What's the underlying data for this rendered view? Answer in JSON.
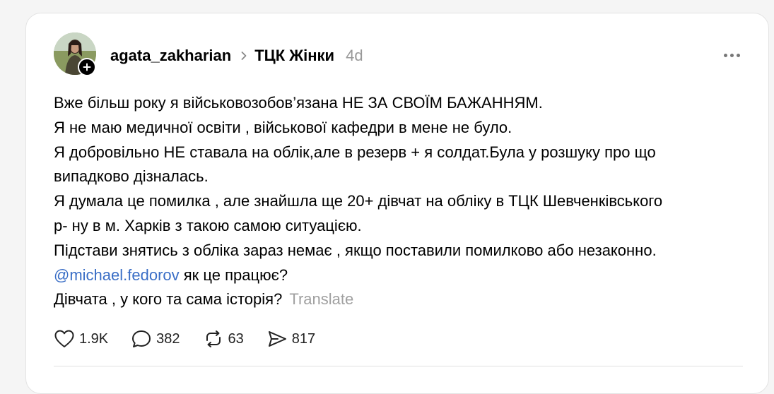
{
  "post": {
    "author": "agata_zakharian",
    "community": "ТЦК Жінки",
    "timestamp": "4d",
    "lines": [
      "Вже більш року я військовозобов’язана НЕ ЗА СВОЇМ БАЖАННЯМ.",
      "Я не маю медичної освіти , військової кафедри в мене не було.",
      "Я добровільно НЕ ставала на облік,але в резерв + я солдат.Була у розшуку про що",
      "випадково дізналась.",
      "Я думала це помилка , але знайшла ще 20+ дівчат на обліку в ТЦК Шевченківського",
      "р- ну в м. Харків з такою самою ситуацією.",
      "Підстави знятись з обліка зараз немає , якщо поставили помилково або незаконно."
    ],
    "mention": "@michael.fedorov",
    "mention_suffix": " як це працює?",
    "last_line": "Дівчата , у кого та сама історія?",
    "translate_label": "Translate"
  },
  "actions": {
    "likes": "1.9K",
    "replies": "382",
    "reposts": "63",
    "shares": "817"
  },
  "icons": {
    "follow": "plus-icon",
    "chevron": "chevron-right-icon",
    "more": "more-dots-icon",
    "like": "heart-icon",
    "reply": "comment-icon",
    "repost": "repost-icon",
    "share": "send-icon"
  },
  "colors": {
    "mention": "#3a6ec6",
    "muted": "#999999",
    "background": "#f5f5f5"
  }
}
